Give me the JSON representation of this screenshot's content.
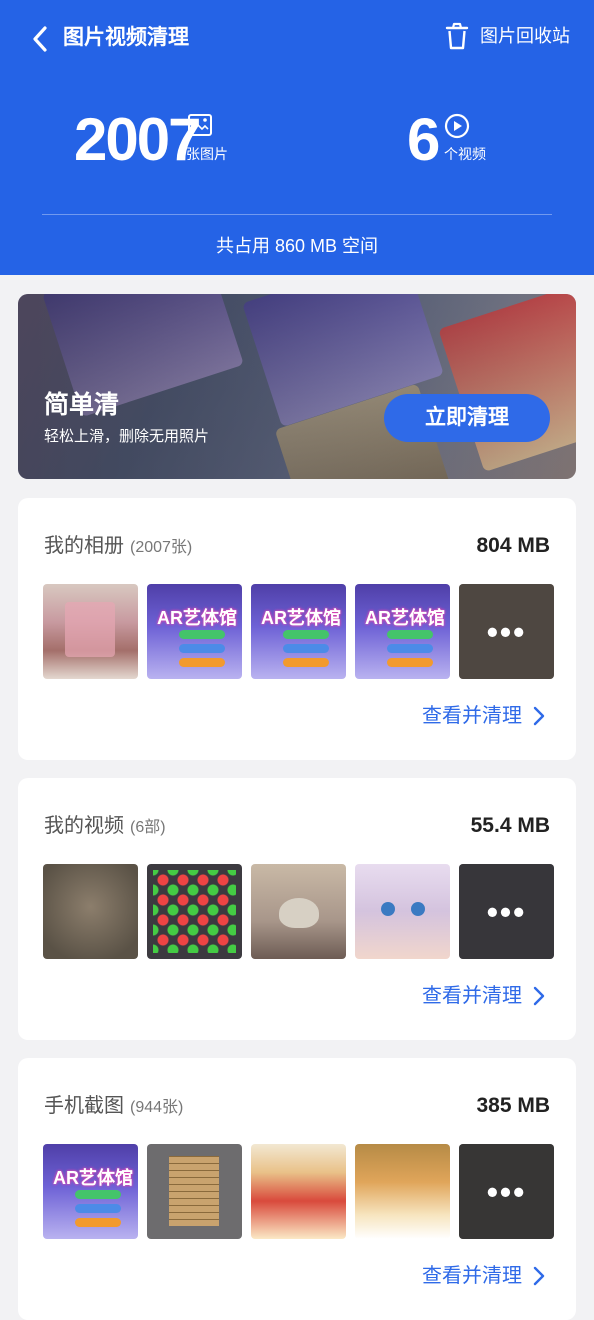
{
  "header": {
    "title": "图片视频清理",
    "trash_label": "图片回收站",
    "photos_count": "2007",
    "photos_unit": "张图片",
    "videos_count": "6",
    "videos_unit": "个视频",
    "total_text": "共占用 860 MB 空间"
  },
  "banner": {
    "title": "简单清",
    "subtitle": "轻松上滑，删除无用照片",
    "button": "立即清理"
  },
  "sections": [
    {
      "title": "我的相册",
      "count": "(2007张)",
      "size": "804 MB",
      "link": "查看并清理"
    },
    {
      "title": "我的视频",
      "count": "(6部)",
      "size": "55.4 MB",
      "link": "查看并清理"
    },
    {
      "title": "手机截图",
      "count": "(944张)",
      "size": "385 MB",
      "link": "查看并清理"
    }
  ],
  "thumb_text": {
    "ar": "AR艺体馆",
    "more": "•••"
  },
  "colors": {
    "header_bg": "#2563e6",
    "accent": "#2f6ae8",
    "page_bg": "#f2f2f4"
  },
  "icons": [
    "back-icon",
    "trash-icon",
    "image-icon",
    "play-circle-icon",
    "chevron-right-icon"
  ]
}
